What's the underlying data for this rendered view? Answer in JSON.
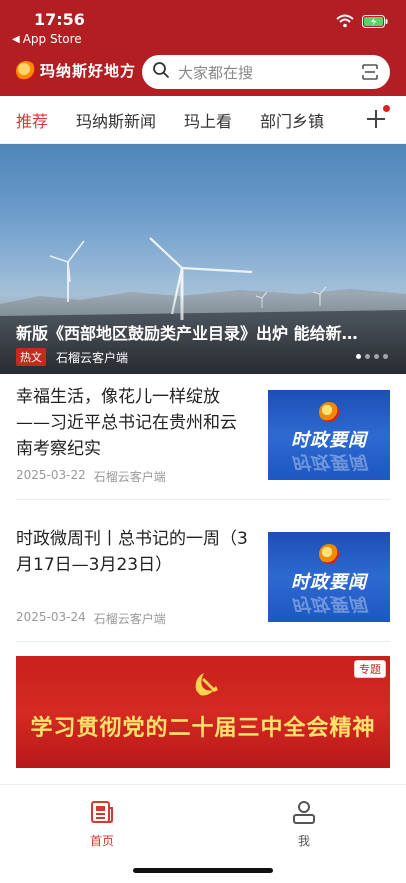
{
  "status_bar": {
    "time": "17:56",
    "back_app": "App Store",
    "icons": [
      "wifi-icon",
      "battery-charging-icon"
    ]
  },
  "app_bar": {
    "logo_text": "玛纳斯好地方",
    "search_placeholder": "大家都在搜"
  },
  "tabs": {
    "items": [
      "推荐",
      "玛纳斯新闻",
      "玛上看",
      "部门乡镇"
    ],
    "active_index": 0
  },
  "banner": {
    "title": "新版《西部地区鼓励类产业目录》出炉 能给新…",
    "badge": "热文",
    "source": "石榴云客户端",
    "page_count": 4,
    "active_page": 0
  },
  "news": [
    {
      "title": "幸福生活，像花儿一样绽放——习近平总书记在贵州和云南考察纪实",
      "date": "2025-03-22",
      "source": "石榴云客户端",
      "thumb_text": "时政要闻"
    },
    {
      "title": "时政微周刊丨总书记的一周（3月17日—3月23日）",
      "date": "2025-03-24",
      "source": "石榴云客户端",
      "thumb_text": "时政要闻"
    }
  ],
  "special": {
    "tag": "专题",
    "slogan": "学习贯彻党的二十届三中全会精神"
  },
  "bottom_nav": {
    "home": "首页",
    "me": "我"
  },
  "colors": {
    "brand_red": "#b21e22",
    "active_tab": "#d83a3a",
    "thumb_blue": "#1c4fb6",
    "slogan_yellow": "#ffe26b"
  }
}
